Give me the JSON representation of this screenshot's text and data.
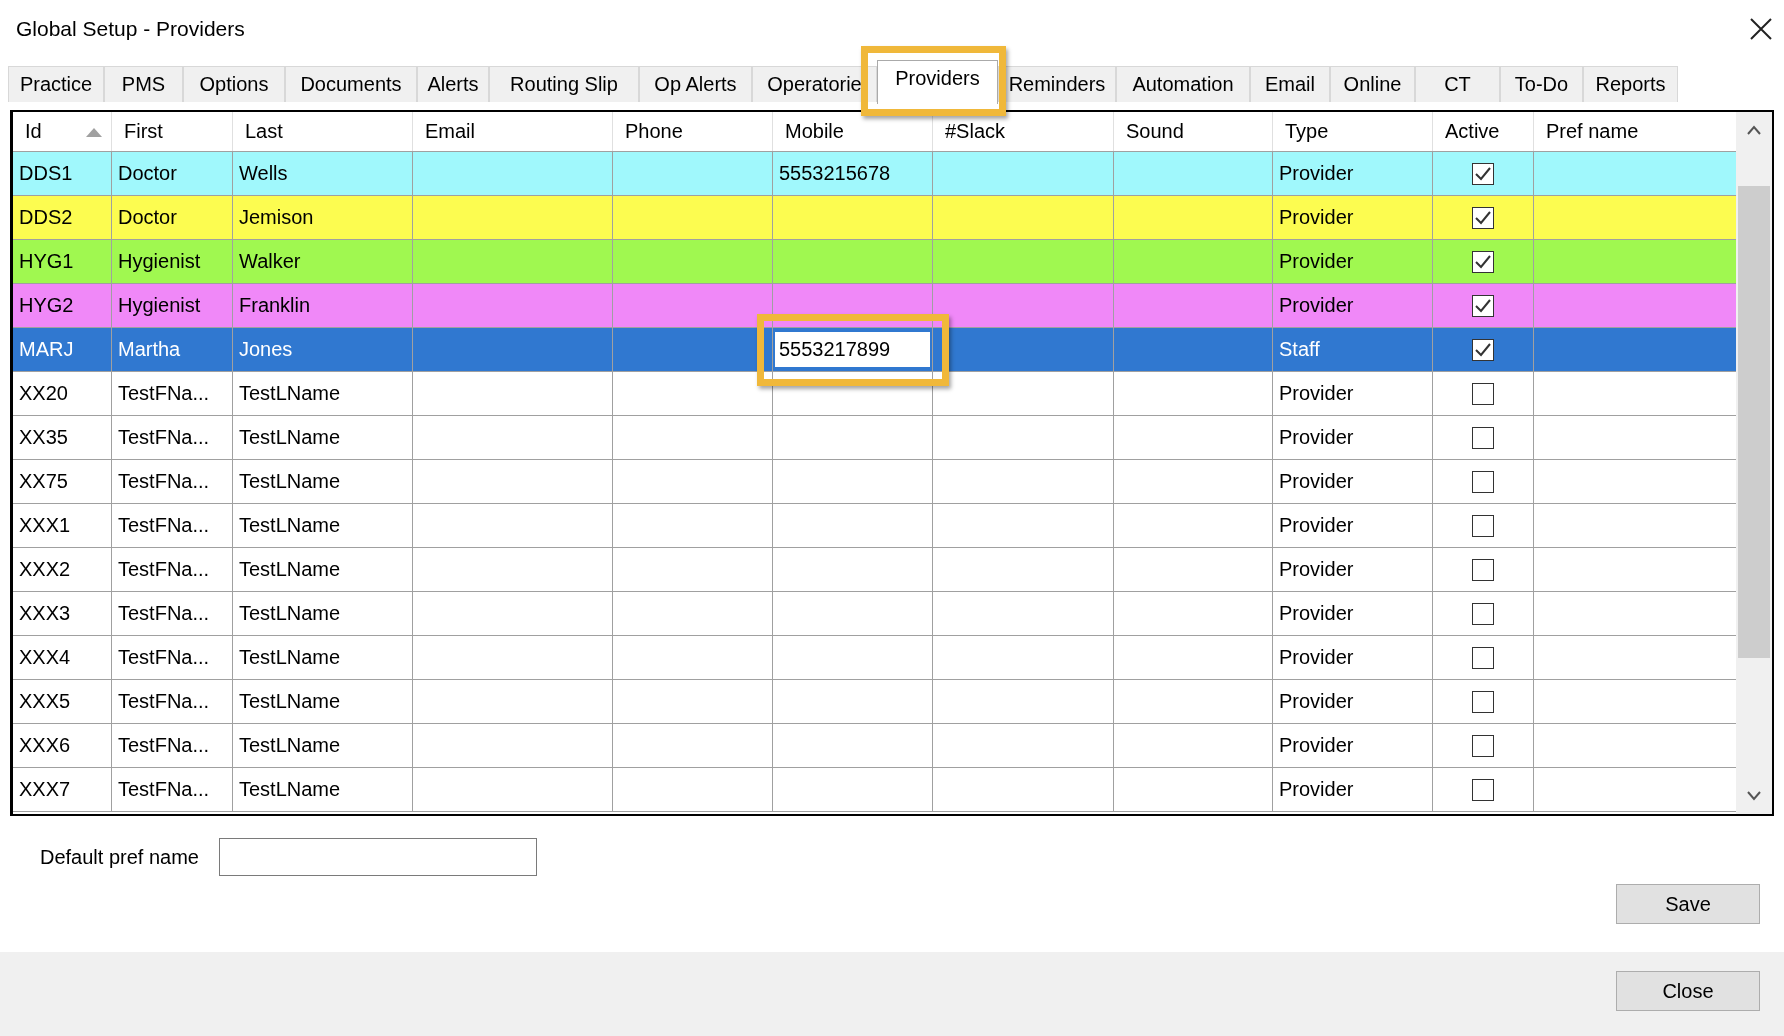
{
  "window": {
    "title": "Global Setup - Providers"
  },
  "tabs": [
    {
      "label": "Practice",
      "selected": false
    },
    {
      "label": "PMS",
      "selected": false
    },
    {
      "label": "Options",
      "selected": false
    },
    {
      "label": "Documents",
      "selected": false
    },
    {
      "label": "Alerts",
      "selected": false
    },
    {
      "label": "Routing Slip",
      "selected": false
    },
    {
      "label": "Op Alerts",
      "selected": false
    },
    {
      "label": "Operatorie",
      "selected": false
    },
    {
      "label": "Providers",
      "selected": true,
      "highlighted": true
    },
    {
      "label": "Reminders",
      "selected": false
    },
    {
      "label": "Automation",
      "selected": false
    },
    {
      "label": "Email",
      "selected": false
    },
    {
      "label": "Online",
      "selected": false
    },
    {
      "label": "CT",
      "selected": false
    },
    {
      "label": "To-Do",
      "selected": false
    },
    {
      "label": "Reports",
      "selected": false
    }
  ],
  "table": {
    "columns": [
      {
        "label": "Id",
        "sorted": true
      },
      {
        "label": "First",
        "sorted": false
      },
      {
        "label": "Last",
        "sorted": false
      },
      {
        "label": "Email",
        "sorted": false
      },
      {
        "label": "Phone",
        "sorted": false
      },
      {
        "label": "Mobile",
        "sorted": false
      },
      {
        "label": "#Slack",
        "sorted": false
      },
      {
        "label": "Sound",
        "sorted": false
      },
      {
        "label": "Type",
        "sorted": false
      },
      {
        "label": "Active",
        "sorted": false
      },
      {
        "label": "Pref name",
        "sorted": false
      }
    ],
    "rows": [
      {
        "id": "DDS1",
        "first": "Doctor",
        "last": "Wells",
        "mobile": "5553215678",
        "type": "Provider",
        "active": true,
        "selected": false,
        "color": "#a0f8fc"
      },
      {
        "id": "DDS2",
        "first": "Doctor",
        "last": "Jemison",
        "type": "Provider",
        "active": true,
        "selected": false,
        "color": "#fcfc50"
      },
      {
        "id": "HYG1",
        "first": "Hygienist",
        "last": "Walker",
        "type": "Provider",
        "active": true,
        "selected": false,
        "color": "#a0f850"
      },
      {
        "id": "HYG2",
        "first": "Hygienist",
        "last": "Franklin",
        "type": "Provider",
        "active": true,
        "selected": false,
        "color": "#f088f8"
      },
      {
        "id": "MARJ",
        "first": "Martha",
        "last": "Jones",
        "mobile": "5553217899",
        "type": "Staff",
        "active": true,
        "selected": true,
        "editing": true,
        "highlighted": true
      },
      {
        "id": "XX20",
        "first": "TestFNa...",
        "last": "TestLName",
        "type": "Provider",
        "active": false,
        "selected": false
      },
      {
        "id": "XX35",
        "first": "TestFNa...",
        "last": "TestLName",
        "type": "Provider",
        "active": false,
        "selected": false
      },
      {
        "id": "XX75",
        "first": "TestFNa...",
        "last": "TestLName",
        "type": "Provider",
        "active": false,
        "selected": false
      },
      {
        "id": "XXX1",
        "first": "TestFNa...",
        "last": "TestLName",
        "type": "Provider",
        "active": false,
        "selected": false
      },
      {
        "id": "XXX2",
        "first": "TestFNa...",
        "last": "TestLName",
        "type": "Provider",
        "active": false,
        "selected": false
      },
      {
        "id": "XXX3",
        "first": "TestFNa...",
        "last": "TestLName",
        "type": "Provider",
        "active": false,
        "selected": false
      },
      {
        "id": "XXX4",
        "first": "TestFNa...",
        "last": "TestLName",
        "type": "Provider",
        "active": false,
        "selected": false
      },
      {
        "id": "XXX5",
        "first": "TestFNa...",
        "last": "TestLName",
        "type": "Provider",
        "active": false,
        "selected": false
      },
      {
        "id": "XXX6",
        "first": "TestFNa...",
        "last": "TestLName",
        "type": "Provider",
        "active": false,
        "selected": false
      },
      {
        "id": "XXX7",
        "first": "TestFNa...",
        "last": "TestLName",
        "type": "Provider",
        "active": false,
        "selected": false
      }
    ]
  },
  "default_pref_name": {
    "label": "Default pref name"
  },
  "buttons": [
    {
      "label": "Save",
      "kind": "panel"
    },
    {
      "label": "Close",
      "kind": "footer"
    }
  ]
}
